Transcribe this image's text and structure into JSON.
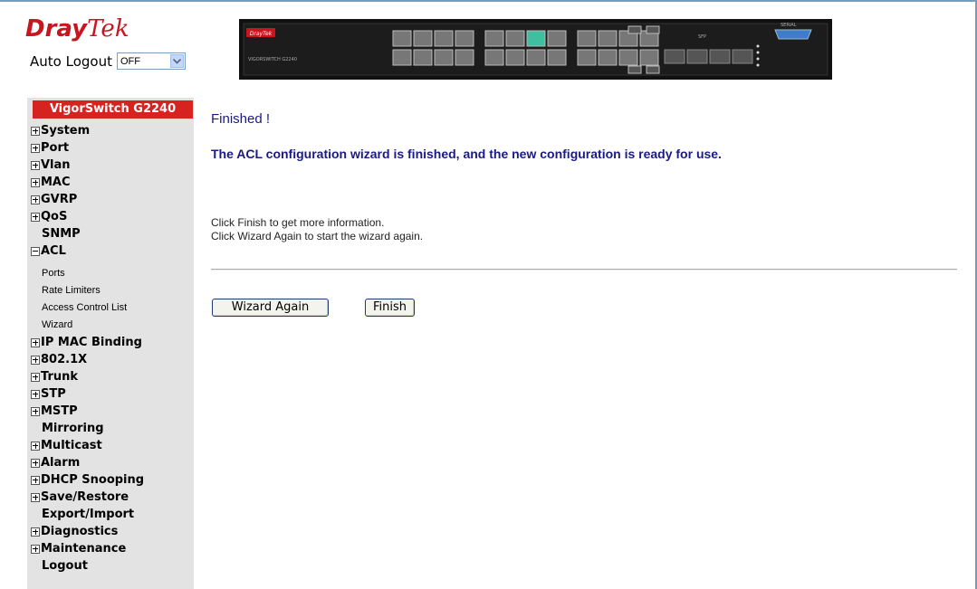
{
  "header": {
    "brand_bold": "Dray",
    "brand_italic": "Tek",
    "auto_logout_label": "Auto Logout",
    "auto_logout_value": "OFF",
    "device_labels": {
      "brand": "DrayTek",
      "model": "VIGORSWITCH G2240",
      "sfp": "SFP",
      "serial": "SERIAL"
    }
  },
  "sidebar": {
    "title": "VigorSwitch G2240",
    "items": [
      {
        "label": "System",
        "icon": "plus"
      },
      {
        "label": "Port",
        "icon": "plus"
      },
      {
        "label": "Vlan",
        "icon": "plus"
      },
      {
        "label": "MAC",
        "icon": "plus"
      },
      {
        "label": "GVRP",
        "icon": "plus"
      },
      {
        "label": "QoS",
        "icon": "plus"
      },
      {
        "label": "SNMP",
        "icon": "none"
      },
      {
        "label": "ACL",
        "icon": "minus"
      },
      {
        "label": "IP MAC Binding",
        "icon": "plus"
      },
      {
        "label": "802.1X",
        "icon": "plus"
      },
      {
        "label": "Trunk",
        "icon": "plus"
      },
      {
        "label": "STP",
        "icon": "plus"
      },
      {
        "label": "MSTP",
        "icon": "plus"
      },
      {
        "label": "Mirroring",
        "icon": "none"
      },
      {
        "label": "Multicast",
        "icon": "plus"
      },
      {
        "label": "Alarm",
        "icon": "plus"
      },
      {
        "label": "DHCP Snooping",
        "icon": "plus"
      },
      {
        "label": "Save/Restore",
        "icon": "plus"
      },
      {
        "label": "Export/Import",
        "icon": "none"
      },
      {
        "label": "Diagnostics",
        "icon": "plus"
      },
      {
        "label": "Maintenance",
        "icon": "plus"
      },
      {
        "label": "Logout",
        "icon": "none"
      }
    ],
    "acl_subitems": [
      "Ports",
      "Rate Limiters",
      "Access Control List",
      "Wizard"
    ]
  },
  "content": {
    "heading": "Finished !",
    "message": "The ACL configuration wizard is finished, and the new configuration is ready for use.",
    "info_line_1": "Click Finish to get more information.",
    "info_line_2": "Click Wizard Again to start the wizard again.",
    "wizard_again_label": "Wizard Again",
    "finish_label": "Finish"
  },
  "colors": {
    "brand_red": "#c8151f",
    "sidebar_title_bg": "#d7231f",
    "heading_blue": "#1a1a86",
    "sidebar_bg": "#e3e3e3"
  }
}
